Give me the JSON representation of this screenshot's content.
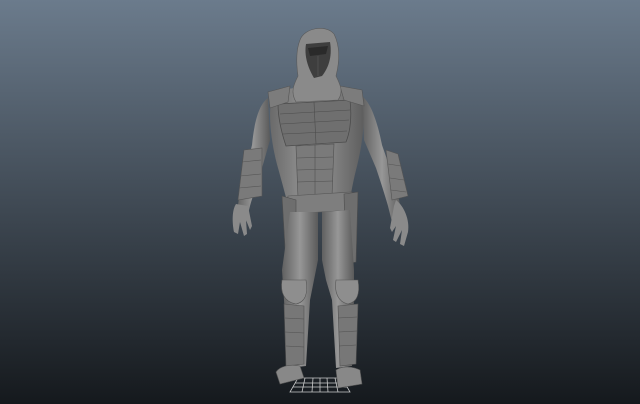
{
  "viewport": {
    "background_top_color": "#6b7b8c",
    "background_bottom_color": "#15191d",
    "model_base_color": "#8a8a8a",
    "model_shadow_color": "#5a5a5a",
    "model_highlight_color": "#a8a8a8",
    "grid_color": "#e8e8e8"
  },
  "scene": {
    "model_icon": "armored-hooded-character-model",
    "ground_icon": "ground-grid"
  }
}
